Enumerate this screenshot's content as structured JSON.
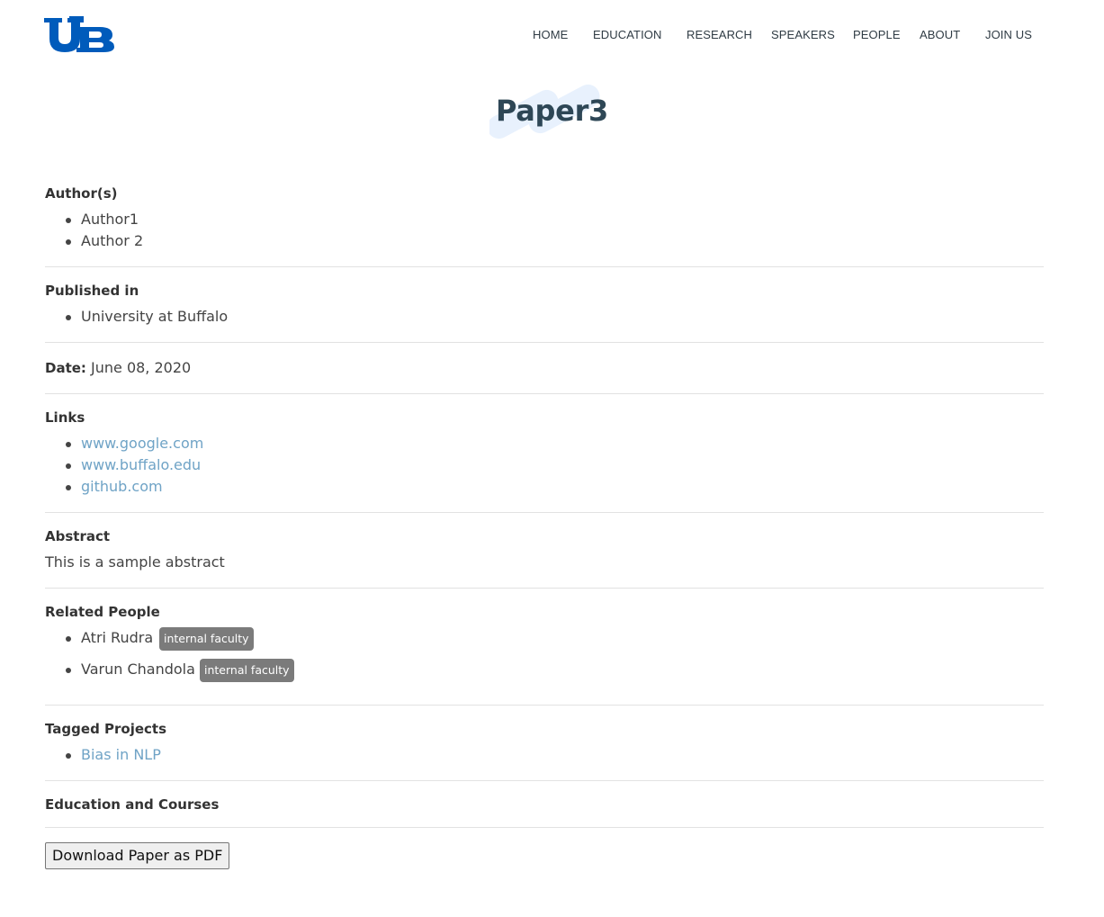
{
  "brand": {
    "logo_text": "UB",
    "logo_color": "#005bbb"
  },
  "nav": {
    "home": "HOME",
    "education": "EDUCATION",
    "research": "RESEARCH",
    "speakers": "SPEAKERS",
    "people": "PEOPLE",
    "about": "ABOUT",
    "join": "JOIN US"
  },
  "page": {
    "title": "Paper3"
  },
  "authors": {
    "label": "Author(s)",
    "items": [
      "Author1",
      "Author 2"
    ]
  },
  "published": {
    "label": "Published in",
    "items": [
      "University at Buffalo"
    ]
  },
  "date": {
    "label": "Date:",
    "value": "June 08, 2020"
  },
  "links": {
    "label": "Links",
    "items": [
      "www.google.com",
      "www.buffalo.edu",
      "github.com"
    ]
  },
  "abstract": {
    "label": "Abstract",
    "text": "This is a sample abstract"
  },
  "related_people": {
    "label": "Related People",
    "items": [
      {
        "name": "Atri Rudra",
        "badge": "internal faculty"
      },
      {
        "name": "Varun Chandola",
        "badge": "internal faculty"
      }
    ]
  },
  "tagged_projects": {
    "label": "Tagged Projects",
    "items": [
      "Bias in NLP"
    ]
  },
  "education": {
    "label": "Education and Courses"
  },
  "download": {
    "label": "Download Paper as PDF"
  },
  "colors": {
    "link": "#6fa3c6",
    "title": "#2e4756",
    "badge": "#7b7b7b"
  }
}
